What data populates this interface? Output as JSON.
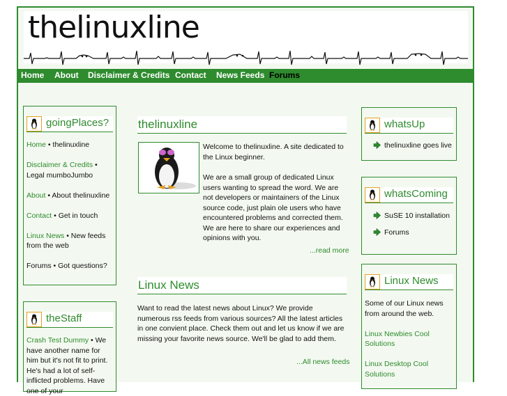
{
  "site": {
    "logo_text": "thelinuxline"
  },
  "nav": [
    "Home",
    "About",
    "Disclaimer & Credits",
    "Contact",
    "News Feeds",
    "Forums"
  ],
  "goingPlaces": {
    "title": "goingPlaces?",
    "items": [
      {
        "link": "Home",
        "desc": " • thelinuxline"
      },
      {
        "link": "Disclaimer & Credits",
        "desc": " • Legal mumboJumbo"
      },
      {
        "link": "About",
        "desc": " • About thelinuxline"
      },
      {
        "link": "Contact",
        "desc": " • Get in touch"
      },
      {
        "link": "Linux News",
        "desc": " • New feeds from the web"
      },
      {
        "link": "Forums",
        "desc": " • Got questions?"
      }
    ]
  },
  "theStaff": {
    "title": "theStaff",
    "link": "Crash Test Dummy",
    "text": " • We have another name for him but it's not fit to print. He's had a lot of self-inflicted problems. Have one of your"
  },
  "main": {
    "intro_title": "thelinuxline",
    "intro_p1": "Welcome to thelinuxline. A site dedicated to the Linux beginner.",
    "intro_p2": "We are a small group of dedicated Linux users wanting to spread the word. We are not developers or maintainers of the Linux source code, just plain ole users who have encountered problems and corrected them. We are here to share our experiences and opinions with you.",
    "read_more": "...read more",
    "news_title": "Linux News",
    "news_text": "Want to read the latest news about Linux? We provide numerous rss feeds from various sources? All the latest articles in one convient place. Check them out and let us know if we are missing your favorite news source. We'll be glad to add them.",
    "all_feeds": "...All news feeds"
  },
  "whatsUp": {
    "title": "whatsUp",
    "items": [
      "thelinuxline goes live"
    ]
  },
  "whatsComing": {
    "title": "whatsComing",
    "items": [
      "SuSE 10 installation",
      "Forums"
    ]
  },
  "linuxNews": {
    "title": "Linux News",
    "intro": "Some of our Linux news from around the web.",
    "links": [
      "Linux Newbies Cool Solutions",
      "Linux Desktop Cool Solutions"
    ]
  },
  "colors": {
    "accent": "#2e8b2e",
    "background": "#f3f9f0",
    "icon_border": "#e8a020"
  }
}
